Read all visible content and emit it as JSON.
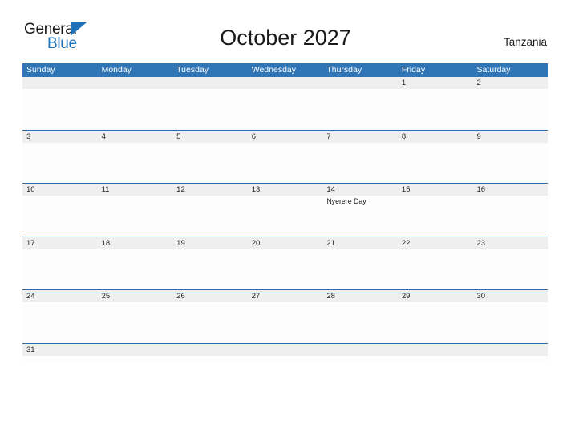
{
  "brand": {
    "name_part1": "General",
    "name_part2": "Blue",
    "logo_colors": {
      "text_dark": "#1a1a1a",
      "blue": "#1f72b8"
    }
  },
  "header": {
    "title": "October 2027",
    "country": "Tanzania"
  },
  "theme": {
    "header_blue": "#3075b5",
    "row_divider_blue": "#2e6da4",
    "date_band_gray": "#efefef",
    "cell_white": "#fdfdfd"
  },
  "calendar": {
    "weekdays": [
      "Sunday",
      "Monday",
      "Tuesday",
      "Wednesday",
      "Thursday",
      "Friday",
      "Saturday"
    ],
    "weeks": [
      {
        "days": [
          {
            "number": "",
            "event": ""
          },
          {
            "number": "",
            "event": ""
          },
          {
            "number": "",
            "event": ""
          },
          {
            "number": "",
            "event": ""
          },
          {
            "number": "",
            "event": ""
          },
          {
            "number": "1",
            "event": ""
          },
          {
            "number": "2",
            "event": ""
          }
        ]
      },
      {
        "days": [
          {
            "number": "3",
            "event": ""
          },
          {
            "number": "4",
            "event": ""
          },
          {
            "number": "5",
            "event": ""
          },
          {
            "number": "6",
            "event": ""
          },
          {
            "number": "7",
            "event": ""
          },
          {
            "number": "8",
            "event": ""
          },
          {
            "number": "9",
            "event": ""
          }
        ]
      },
      {
        "days": [
          {
            "number": "10",
            "event": ""
          },
          {
            "number": "11",
            "event": ""
          },
          {
            "number": "12",
            "event": ""
          },
          {
            "number": "13",
            "event": ""
          },
          {
            "number": "14",
            "event": "Nyerere Day"
          },
          {
            "number": "15",
            "event": ""
          },
          {
            "number": "16",
            "event": ""
          }
        ]
      },
      {
        "days": [
          {
            "number": "17",
            "event": ""
          },
          {
            "number": "18",
            "event": ""
          },
          {
            "number": "19",
            "event": ""
          },
          {
            "number": "20",
            "event": ""
          },
          {
            "number": "21",
            "event": ""
          },
          {
            "number": "22",
            "event": ""
          },
          {
            "number": "23",
            "event": ""
          }
        ]
      },
      {
        "days": [
          {
            "number": "24",
            "event": ""
          },
          {
            "number": "25",
            "event": ""
          },
          {
            "number": "26",
            "event": ""
          },
          {
            "number": "27",
            "event": ""
          },
          {
            "number": "28",
            "event": ""
          },
          {
            "number": "29",
            "event": ""
          },
          {
            "number": "30",
            "event": ""
          }
        ]
      },
      {
        "last": true,
        "days": [
          {
            "number": "31",
            "event": ""
          },
          {
            "number": "",
            "event": ""
          },
          {
            "number": "",
            "event": ""
          },
          {
            "number": "",
            "event": ""
          },
          {
            "number": "",
            "event": ""
          },
          {
            "number": "",
            "event": ""
          },
          {
            "number": "",
            "event": ""
          }
        ]
      }
    ]
  }
}
